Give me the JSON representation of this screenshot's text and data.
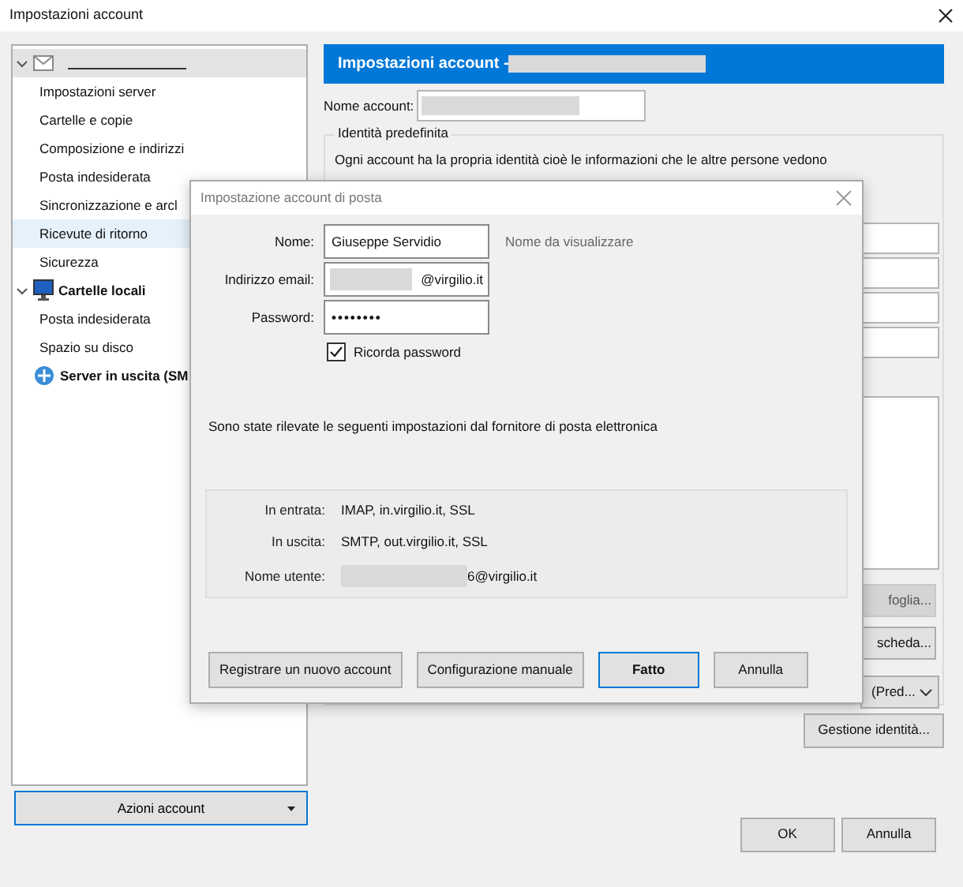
{
  "window": {
    "title": "Impostazioni account"
  },
  "tree": [
    {
      "kind": "account",
      "expanded": true,
      "selected": true,
      "hovered": false,
      "children": [
        {
          "label": "Impostazioni server",
          "selected": false,
          "hovered": false
        },
        {
          "label": "Cartelle e copie",
          "selected": false,
          "hovered": false
        },
        {
          "label": "Composizione e indirizzi",
          "selected": false,
          "hovered": false
        },
        {
          "label": "Posta indesiderata",
          "selected": false,
          "hovered": false
        },
        {
          "label": "Sincronizzazione e arcl",
          "selected": false,
          "hovered": false
        },
        {
          "label": "Ricevute di ritorno",
          "selected": false,
          "hovered": true
        },
        {
          "label": "Sicurezza",
          "selected": false,
          "hovered": false
        }
      ]
    },
    {
      "kind": "local",
      "label": "Cartelle locali",
      "expanded": true,
      "selected": false,
      "hovered": false,
      "children": [
        {
          "label": "Posta indesiderata",
          "selected": false,
          "hovered": false
        },
        {
          "label": "Spazio su disco",
          "selected": false,
          "hovered": false
        }
      ]
    },
    {
      "kind": "server",
      "label": "Server in uscita (SM",
      "selected": false,
      "hovered": false
    }
  ],
  "account_actions": {
    "label": "Azioni account"
  },
  "settings_panel": {
    "header": "Impostazioni account - ",
    "account_name_label": "Nome account:",
    "identity_group": "Identità predefinita",
    "identity_text": "Ogni account ha la propria identità cioè le informazioni che le altre persone vedono",
    "partial_buttons": [
      "foglia...",
      "scheda..."
    ],
    "dropdown": "(Pred...",
    "manage_button": "Gestione identità..."
  },
  "footer_buttons": [
    "OK",
    "Annulla"
  ],
  "dialog": {
    "title": "Impostazione account di posta",
    "fields": [
      {
        "kind": "text",
        "label": "Nome:",
        "value": "Giuseppe Servidio",
        "hint": "Nome da visualizzare"
      },
      {
        "kind": "redacted",
        "label": "Indirizzo email:",
        "value": "@virgilio.it"
      },
      {
        "kind": "password",
        "label": "Password:",
        "value": "••••••••"
      }
    ],
    "remember": {
      "label": "Ricorda password",
      "checked": true
    },
    "notice": "Sono state rilevate le seguenti impostazioni dal fornitore di posta elettronica",
    "settings": [
      {
        "label": "In entrata:",
        "value": "IMAP, in.virgilio.it, SSL",
        "redacted": false
      },
      {
        "label": "In uscita:",
        "value": "SMTP, out.virgilio.it, SSL",
        "redacted": false
      },
      {
        "label": "Nome utente:",
        "value": "6@virgilio.it",
        "redacted": true
      }
    ],
    "buttons": [
      {
        "label": "Registrare un nuovo account",
        "default": false
      },
      {
        "label": "Configurazione manuale",
        "default": false
      },
      {
        "label": "Fatto",
        "default": true
      },
      {
        "label": "Annulla",
        "default": false
      }
    ]
  }
}
